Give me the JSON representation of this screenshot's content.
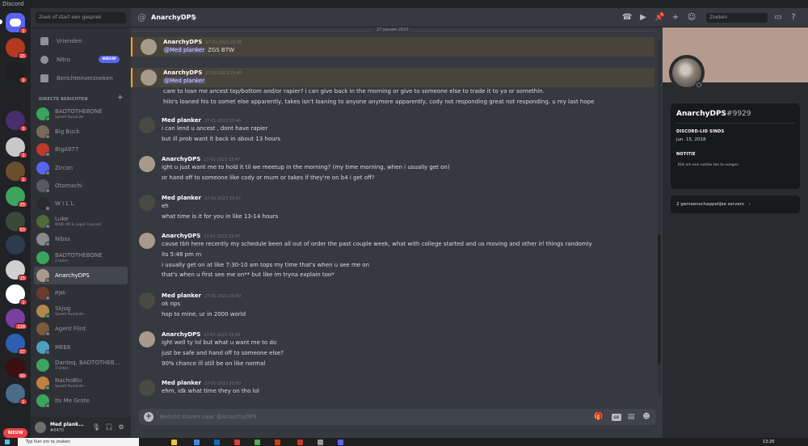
{
  "window": {
    "title": "Discord"
  },
  "servers": [
    {
      "badge": "1",
      "color": "#5865f2"
    },
    {
      "badge": "15",
      "color": "#b33a1e"
    },
    {
      "badge": "2",
      "color": "#1e1e1e"
    },
    {
      "badge": "",
      "color": "#222222"
    },
    {
      "badge": "3",
      "color": "#4a2e6b"
    },
    {
      "badge": "1",
      "color": "#c8c8c8"
    },
    {
      "badge": "1",
      "color": "#6b4e2e"
    },
    {
      "badge": "25",
      "color": "#3ba55d"
    },
    {
      "badge": "53",
      "color": "#3a4a3a"
    },
    {
      "badge": "",
      "color": "#2e3b4f"
    },
    {
      "badge": "15",
      "color": "#d0d0d0"
    },
    {
      "badge": "2",
      "color": "#ffffff"
    },
    {
      "badge": "228",
      "color": "#7b3fa0"
    },
    {
      "badge": "37",
      "color": "#2f5fb3"
    },
    {
      "badge": "40",
      "color": "#3a0f0f"
    },
    {
      "badge": "1",
      "color": "#4a6b8a"
    }
  ],
  "rail": {
    "new_label": "NIEUW"
  },
  "dm_sidebar": {
    "search_placeholder": "Zoek of start een gesprek",
    "nav": {
      "friends": "Vrienden",
      "nitro": "Nitro",
      "nitro_badge": "NIEUW",
      "requests": "Berichtenverzoeken"
    },
    "header": "DIRECTE BERICHTEN",
    "dms": [
      {
        "name": "BADTOTHEBONE",
        "sub": "Speelt RuneLite",
        "status": "on",
        "color": "#3ba55d"
      },
      {
        "name": "Big Buck",
        "sub": "",
        "status": "off",
        "color": "#7a6a5a"
      },
      {
        "name": "BigA977",
        "sub": "",
        "status": "off",
        "color": "#c0392b"
      },
      {
        "name": "Zircon",
        "sub": "",
        "status": "off",
        "color": "#5865f2"
      },
      {
        "name": "Otomachi",
        "sub": "",
        "status": "off",
        "color": "#555a5e"
      },
      {
        "name": "W I L L",
        "sub": "",
        "status": "off",
        "color": "#2a2a2a"
      },
      {
        "name": "Luke",
        "sub": "WDR HR & Legal Counsel",
        "status": "off",
        "color": "#4f6b3a"
      },
      {
        "name": "Nibss",
        "sub": "",
        "status": "off",
        "color": "#8a8a8a"
      },
      {
        "name": "BADTOTHEBONE",
        "sub": "2 leden",
        "status": "group",
        "color": "#3ba55d"
      },
      {
        "name": "AnarchyDPS",
        "sub": "",
        "status": "off",
        "color": "#a89a8a"
      },
      {
        "name": "PjM-",
        "sub": "",
        "status": "off",
        "color": "#6b3b2b"
      },
      {
        "name": "Skjug",
        "sub": "Speelt RuneLite",
        "status": "on",
        "color": "#b3884f"
      },
      {
        "name": "Agent Flint",
        "sub": "",
        "status": "off",
        "color": "#7a5a3a"
      },
      {
        "name": "MEE6",
        "sub": "",
        "status": "off",
        "color": "#4fa0c0"
      },
      {
        "name": "Danteq, BADTOTHEB...",
        "sub": "3 leden",
        "status": "group",
        "color": "#3ba55d"
      },
      {
        "name": "NachoBlu",
        "sub": "Speelt RuneLite",
        "status": "on",
        "color": "#c08040"
      },
      {
        "name": "Its Me Grote",
        "sub": "",
        "status": "off",
        "color": "#3ba55d"
      }
    ],
    "active_index": 9,
    "user": {
      "name": "Med plank...",
      "tag": "#6470"
    }
  },
  "chat": {
    "header_name": "AnarchyDPS",
    "search_placeholder": "Zoeken",
    "date_divider": "27 januari 2023",
    "composer_placeholder": "Bericht sturen naar @AnarchyDPS",
    "gif_label": "GIF",
    "messages": [
      {
        "author": "AnarchyDPS",
        "time": "27-01-2023 23:35",
        "mention": true,
        "mention_text": "@Med planker",
        "lines": [
          "ZGS BTW"
        ],
        "avatar": "#a89a8a"
      },
      {
        "author": "AnarchyDPS",
        "time": "27-01-2023 23:45",
        "mention": true,
        "mention_text": "@Med planker",
        "lines": [
          "care to loan me ancest top/bottom and/or rapier?  i can give back in the morning or give to someone else to trade it to ya or somethin.",
          "hilo's loaned his to somet else apparently, takes isn't loaning to anyone anymore apparently, cody not responding great not responding.  u my last hope"
        ],
        "avatar": "#a89a8a"
      },
      {
        "author": "Med planker",
        "time": "27-01-2023 23:46",
        "mention": false,
        "lines": [
          "i can lend u ancest , dont have rapier",
          "but ill prob want it back in about 13 hours"
        ],
        "avatar": "#4a4a44"
      },
      {
        "author": "AnarchyDPS",
        "time": "27-01-2023 23:47",
        "mention": false,
        "lines": [
          "ight u just want me to hold it til we meetup in the morning? (my time morning, when i usually get on)",
          "or hand off to someone like cody or mum or takes if they're on b4 i get off?"
        ],
        "avatar": "#a89a8a"
      },
      {
        "author": "Med planker",
        "time": "27-01-2023 23:47",
        "mention": false,
        "lines": [
          "eh",
          "what time is it for you in like 13-14 hours"
        ],
        "avatar": "#4a4a44"
      },
      {
        "author": "AnarchyDPS",
        "time": "27-01-2023 23:47",
        "mention": false,
        "lines": [
          "cause tbh here recently my schedule been all out of order the past couple week, what with college started and us moving and other irl things randomly",
          "its 5:48 pm rn",
          "i usually get on at like 7:30-10 am tops my time that's when u see me on",
          "that's when u first see me on** but like im tryna explain too*"
        ],
        "avatar": "#a89a8a"
      },
      {
        "author": "Med planker",
        "time": "27-01-2023 23:49",
        "mention": false,
        "lines": [
          "ok nps",
          "hop to mine, ur in 2000 world"
        ],
        "avatar": "#4a4a44"
      },
      {
        "author": "AnarchyDPS",
        "time": "27-01-2023 23:50",
        "mention": false,
        "lines": [
          "ight well ty lol but what u want me to do",
          "just be safe and hand off to someone else?",
          "90% chance ill still be on like normal"
        ],
        "avatar": "#a89a8a"
      },
      {
        "author": "Med planker",
        "time": "27-01-2023 23:50",
        "mention": false,
        "lines": [
          "ehm, idk what time they on tho lol"
        ],
        "avatar": "#4a4a44"
      }
    ]
  },
  "profile": {
    "name": "AnarchyDPS",
    "discriminator": "#9929",
    "member_since_label": "DISCORD-LID SINDS",
    "member_since": "jun. 15, 2018",
    "note_label": "NOTITIE",
    "note_placeholder": "Klik om een notitie toe te voegen",
    "mutual_servers": "2 gemeenschappelijke servers",
    "banner_color": "#b49b8e"
  },
  "taskbar": {
    "search_placeholder": "Typ hier om te zoeken",
    "clock": "13:20"
  }
}
